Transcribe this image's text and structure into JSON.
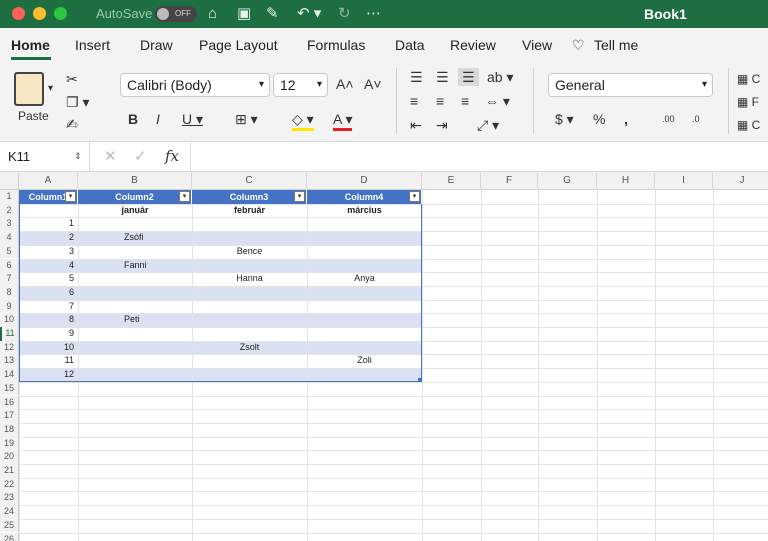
{
  "window": {
    "title": "Book1",
    "autosave_label": "AutoSave",
    "autosave_state": "OFF"
  },
  "tabs": [
    "Home",
    "Insert",
    "Draw",
    "Page Layout",
    "Formulas",
    "Data",
    "Review",
    "View",
    "Tell me"
  ],
  "ribbon": {
    "paste_label": "Paste",
    "font_name": "Calibri (Body)",
    "font_size": "12",
    "number_format": "General",
    "styles_partial": [
      "C",
      "F",
      "C"
    ]
  },
  "formula_bar": {
    "cell_ref": "K11",
    "fx": "fx",
    "content": ""
  },
  "sheet": {
    "columns": [
      "A",
      "B",
      "C",
      "D",
      "E",
      "F",
      "G",
      "H",
      "I",
      "J"
    ],
    "rows": [
      "1",
      "2",
      "3",
      "4",
      "5",
      "6",
      "7",
      "8",
      "9",
      "10",
      "11",
      "12",
      "13",
      "14",
      "15",
      "16",
      "17",
      "18",
      "19",
      "20",
      "21",
      "22",
      "23",
      "24",
      "25",
      "26"
    ],
    "table_headers": [
      "Column1",
      "Column2",
      "Column3",
      "Column4"
    ],
    "months": [
      "január",
      "február",
      "március"
    ],
    "col_a": [
      "1",
      "2",
      "3",
      "4",
      "5",
      "6",
      "7",
      "8",
      "9",
      "10",
      "11",
      "12"
    ],
    "entries": [
      {
        "row": 4,
        "col": "B",
        "text": "Zsófi"
      },
      {
        "row": 5,
        "col": "C",
        "text": "Bence"
      },
      {
        "row": 6,
        "col": "B",
        "text": "Fanni"
      },
      {
        "row": 7,
        "col": "C",
        "text": "Hanna"
      },
      {
        "row": 7,
        "col": "D",
        "text": "Anya"
      },
      {
        "row": 10,
        "col": "B",
        "text": "Peti"
      },
      {
        "row": 12,
        "col": "C",
        "text": "Zsolt"
      },
      {
        "row": 13,
        "col": "D",
        "text": "Zoli"
      }
    ]
  },
  "colors": {
    "accent": "#1d6f42",
    "table_header": "#4472c4",
    "band": "#d9e1f2"
  }
}
